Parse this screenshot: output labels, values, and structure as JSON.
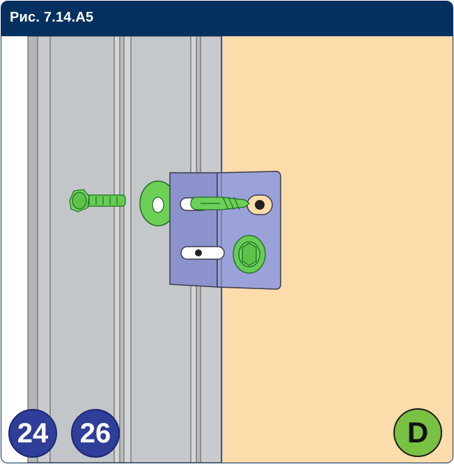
{
  "figure": {
    "title": "Рис. 7.14.A5"
  },
  "badges": {
    "left_first": "24",
    "left_second": "26",
    "right": "D"
  },
  "colors": {
    "header": "#05305f",
    "wall": "#fbdcaa",
    "profile": "#c4c7ca",
    "bracket": "#9aa0d8",
    "fastener": "#6dd46a",
    "badge_blue": "#2f3e99",
    "badge_green": "#79c143"
  }
}
